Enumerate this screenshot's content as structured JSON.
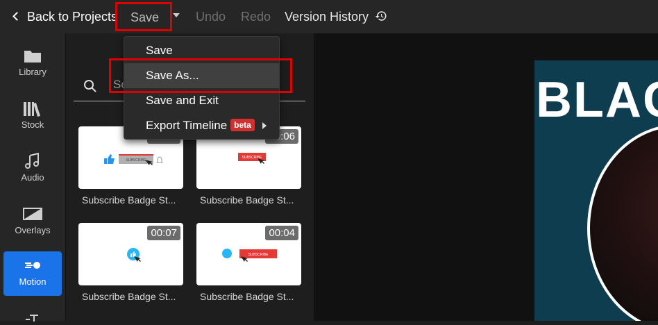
{
  "topbar": {
    "back_label": "Back to Projects",
    "save_label": "Save",
    "undo_label": "Undo",
    "redo_label": "Redo",
    "version_history_label": "Version History"
  },
  "sidebar": {
    "items": [
      {
        "label": "Library",
        "icon": "folder-icon"
      },
      {
        "label": "Stock",
        "icon": "books-icon"
      },
      {
        "label": "Audio",
        "icon": "music-note-icon"
      },
      {
        "label": "Overlays",
        "icon": "overlay-icon"
      },
      {
        "label": "Motion",
        "icon": "motion-icon",
        "active": true
      }
    ]
  },
  "search": {
    "placeholder": "Se"
  },
  "cards": [
    {
      "duration": "00:06",
      "caption": "Subscribe Badge St..."
    },
    {
      "duration": "00:06",
      "caption": "Subscribe Badge St..."
    },
    {
      "duration": "00:07",
      "caption": "Subscribe Badge St..."
    },
    {
      "duration": "00:04",
      "caption": "Subscribe Badge St..."
    }
  ],
  "thumb_text": {
    "subscribe": "SUBSCRIBE"
  },
  "dropdown": {
    "items": [
      {
        "label": "Save"
      },
      {
        "label": "Save As..."
      },
      {
        "label": "Save and Exit"
      },
      {
        "label": "Export Timeline",
        "badge": "beta"
      }
    ]
  },
  "preview": {
    "title": "BLAC"
  },
  "colors": {
    "accent": "#1a73e8",
    "highlight": "#e10000",
    "beta": "#d32f2f"
  }
}
